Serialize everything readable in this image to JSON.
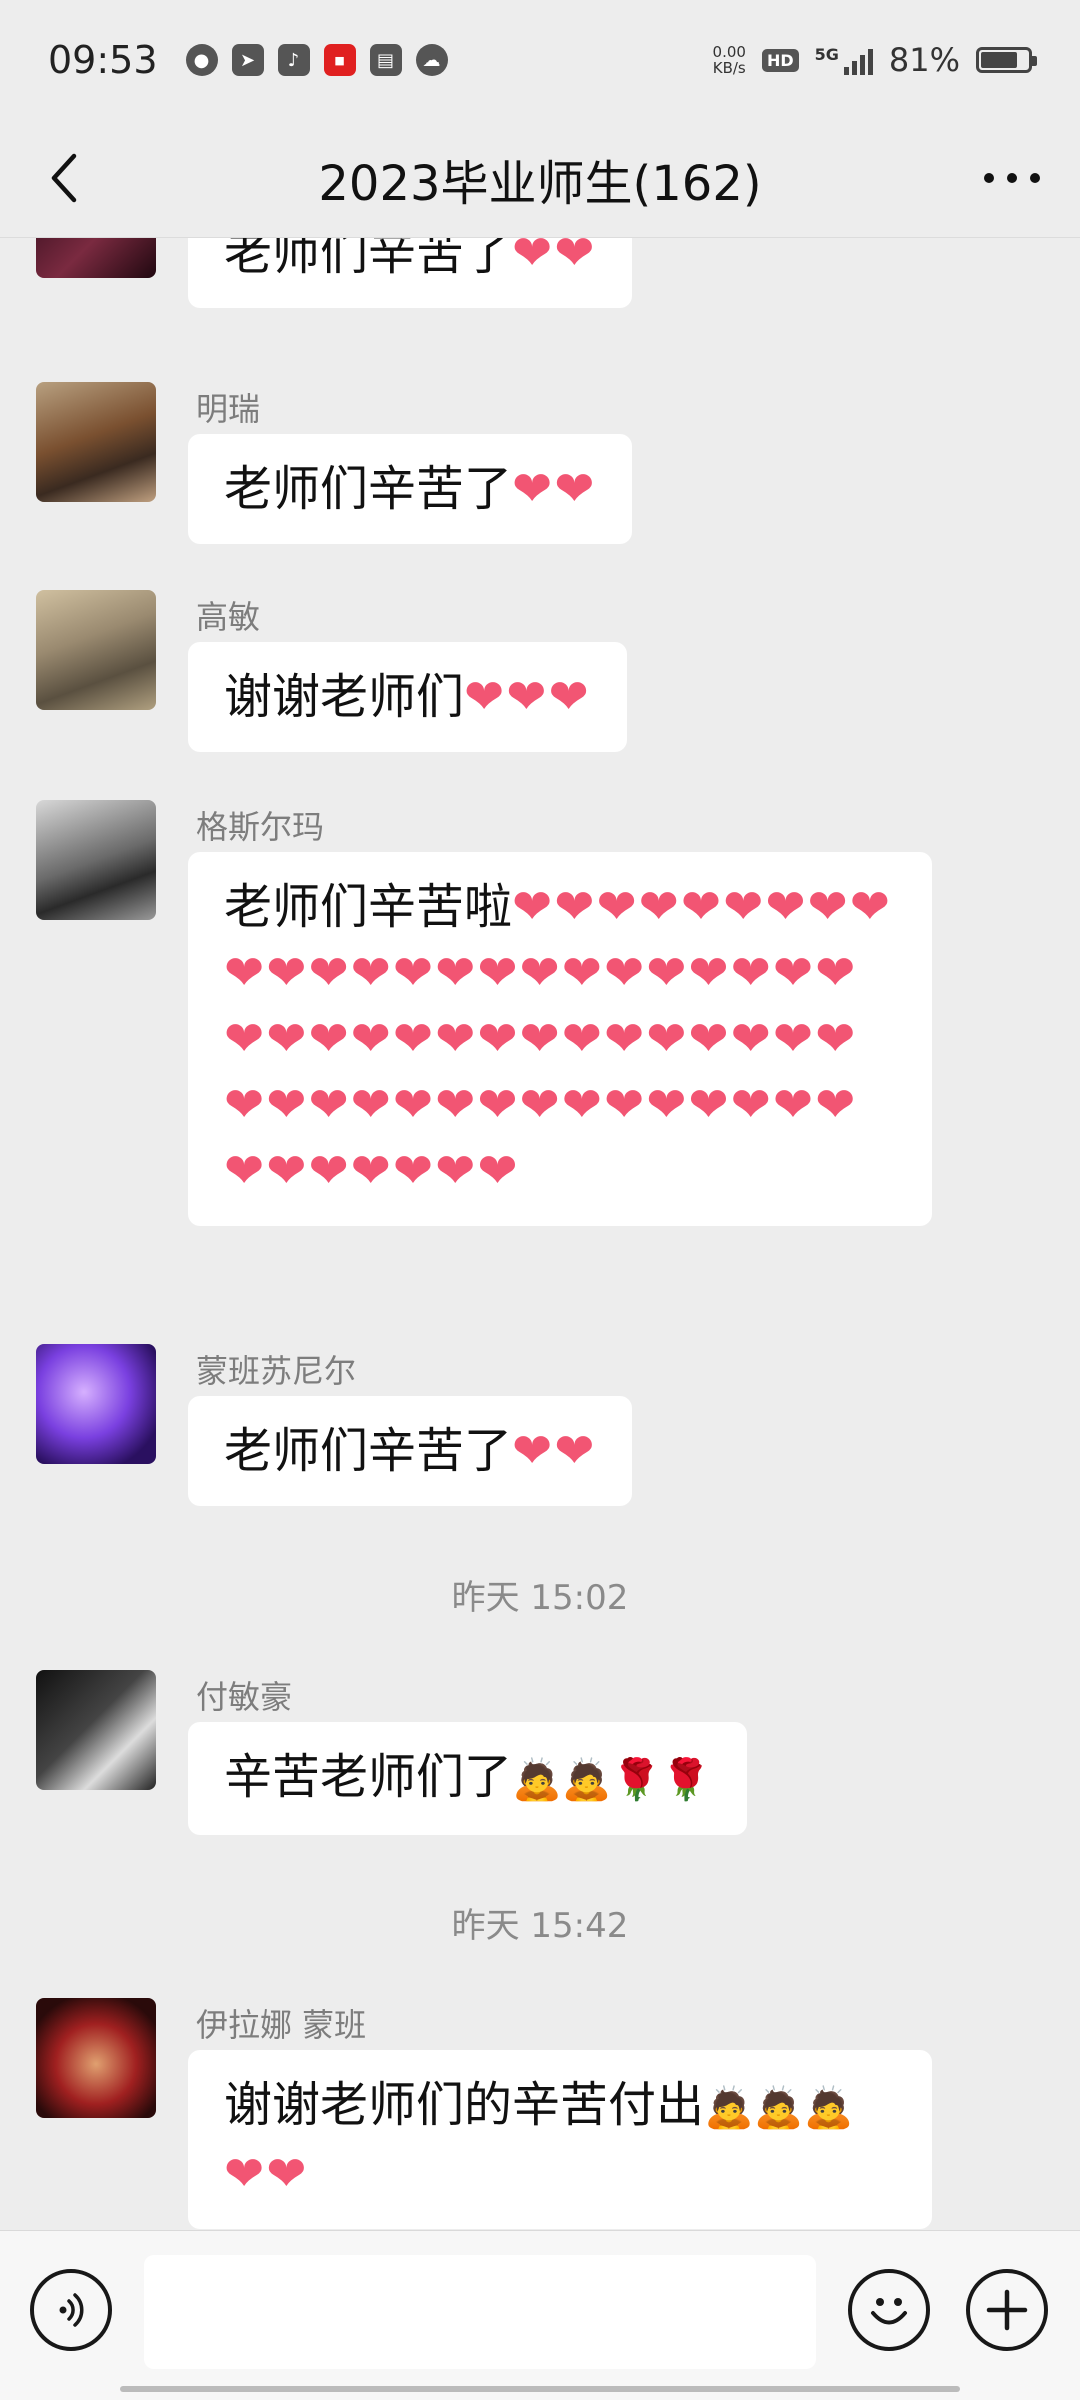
{
  "status_bar": {
    "time": "09:53",
    "net_speed_value": "0.00",
    "net_speed_unit": "KB/s",
    "hd": "HD",
    "network": "5G",
    "battery": "81%"
  },
  "header": {
    "title": "2023毕业师生(162)"
  },
  "messages": [
    {
      "sender": "",
      "text": "老师们辛苦了",
      "hearts": "❤❤"
    },
    {
      "sender": "明瑞",
      "text": "老师们辛苦了",
      "hearts": "❤❤"
    },
    {
      "sender": "高敏",
      "text": "谢谢老师们",
      "hearts": "❤❤❤"
    },
    {
      "sender": "格斯尔玛",
      "text": "老师们辛苦啦",
      "hearts_line1": "❤❤❤❤❤❤",
      "hearts_lines": "❤❤❤❤❤❤❤❤❤❤❤❤❤❤❤❤❤❤❤❤❤❤❤❤❤❤❤❤❤❤❤❤❤❤❤❤❤❤❤❤❤❤❤❤❤❤❤❤❤❤❤❤❤❤❤"
    },
    {
      "sender": "蒙班苏尼尔",
      "text": "老师们辛苦了",
      "hearts": "❤❤"
    },
    {
      "sender": "付敏豪",
      "text": "辛苦老师们了",
      "emoji": "🙇🙇🌹🌹"
    },
    {
      "sender": "伊拉娜 蒙班",
      "text": "谢谢老师们的辛苦付出",
      "emoji": "🙇🙇🙇",
      "hearts": "❤❤"
    }
  ],
  "timestamps": [
    "昨天 15:02",
    "昨天 15:42"
  ],
  "colors": {
    "background": "#ededed",
    "bubble": "#ffffff",
    "heart": "#f25573",
    "sender_name": "#7d7d7d"
  },
  "icons": {
    "voice": "voice-icon",
    "emoji": "emoji-icon",
    "plus": "plus-icon",
    "back": "chevron-left-icon",
    "more": "more-icon"
  }
}
